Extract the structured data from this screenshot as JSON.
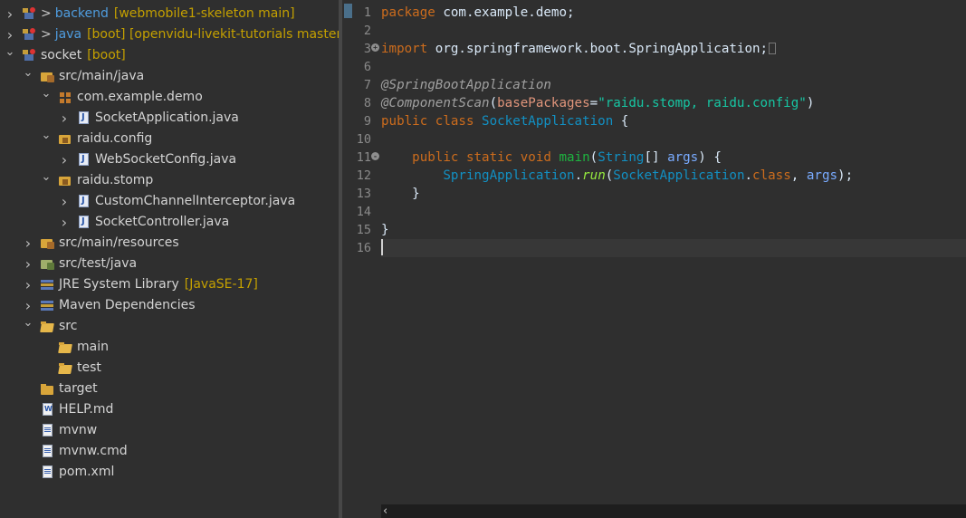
{
  "explorer": {
    "rows": [
      {
        "prefix": ">",
        "label": "backend",
        "decoration": "[webmobile1-skeleton main]",
        "icon": "project-icon"
      },
      {
        "prefix": ">",
        "label": "java",
        "decoration": "[boot] [openvidu-livekit-tutorials master]",
        "icon": "project-icon"
      },
      {
        "label": "socket",
        "decoration": "[boot]",
        "icon": "project-icon"
      },
      {
        "label": "src/main/java",
        "icon": "source-folder-icon"
      },
      {
        "label": "com.example.demo",
        "icon": "package-icon"
      },
      {
        "label": "SocketApplication.java",
        "icon": "java-file-icon"
      },
      {
        "label": "raidu.config",
        "icon": "package-icon"
      },
      {
        "label": "WebSocketConfig.java",
        "icon": "java-file-icon"
      },
      {
        "label": "raidu.stomp",
        "icon": "package-icon"
      },
      {
        "label": "CustomChannelInterceptor.java",
        "icon": "java-file-icon"
      },
      {
        "label": "SocketController.java",
        "icon": "java-file-icon"
      },
      {
        "label": "src/main/resources",
        "icon": "source-folder-icon"
      },
      {
        "label": "src/test/java",
        "icon": "test-folder-icon"
      },
      {
        "label": "JRE System Library",
        "decoration": "[JavaSE-17]",
        "icon": "library-icon"
      },
      {
        "label": "Maven Dependencies",
        "icon": "library-icon"
      },
      {
        "label": "src",
        "icon": "folder-open-icon"
      },
      {
        "label": "main",
        "icon": "folder-open-icon"
      },
      {
        "label": "test",
        "icon": "folder-open-icon"
      },
      {
        "label": "target",
        "icon": "folder-icon"
      },
      {
        "label": "HELP.md",
        "icon": "markdown-file-icon"
      },
      {
        "label": "mvnw",
        "icon": "file-icon"
      },
      {
        "label": "mvnw.cmd",
        "icon": "file-icon"
      },
      {
        "label": "pom.xml",
        "icon": "xml-file-icon"
      }
    ]
  },
  "editor": {
    "line_numbers": [
      "1",
      "2",
      "3",
      "6",
      "7",
      "8",
      "9",
      "10",
      "11",
      "12",
      "13",
      "14",
      "15",
      "16"
    ],
    "fold_markers": {
      "3": "+",
      "11": "-"
    },
    "code": {
      "l1_kw": "package",
      "l1_rest": " com.example.demo;",
      "l3_kw": "import",
      "l3_rest": " org.springframework.boot.SpringApplication;",
      "l7_ann": "@SpringBootApplication",
      "l8_ann": "@ComponentScan",
      "l8_open": "(",
      "l8_attr": "basePackages",
      "l8_eq": "=",
      "l8_str": "\"raidu.stomp, raidu.config\"",
      "l8_close": ")",
      "l9_kw": "public class",
      "l9_cls": "SocketApplication",
      "l9_brace": " {",
      "l11_kw": "public static void",
      "l11_mth": "main",
      "l11_open": "(",
      "l11_type": "String",
      "l11_arr": "[] ",
      "l11_prm": "args",
      "l11_close": ") {",
      "l12_cls": "SpringApplication",
      "l12_dot": ".",
      "l12_smth": "run",
      "l12_open": "(",
      "l12_cls2": "SocketApplication",
      "l12_dot2": ".",
      "l12_kw": "class",
      "l12_comma": ", ",
      "l12_prm": "args",
      "l12_close": ");",
      "l13": "}",
      "l15": "}"
    }
  }
}
